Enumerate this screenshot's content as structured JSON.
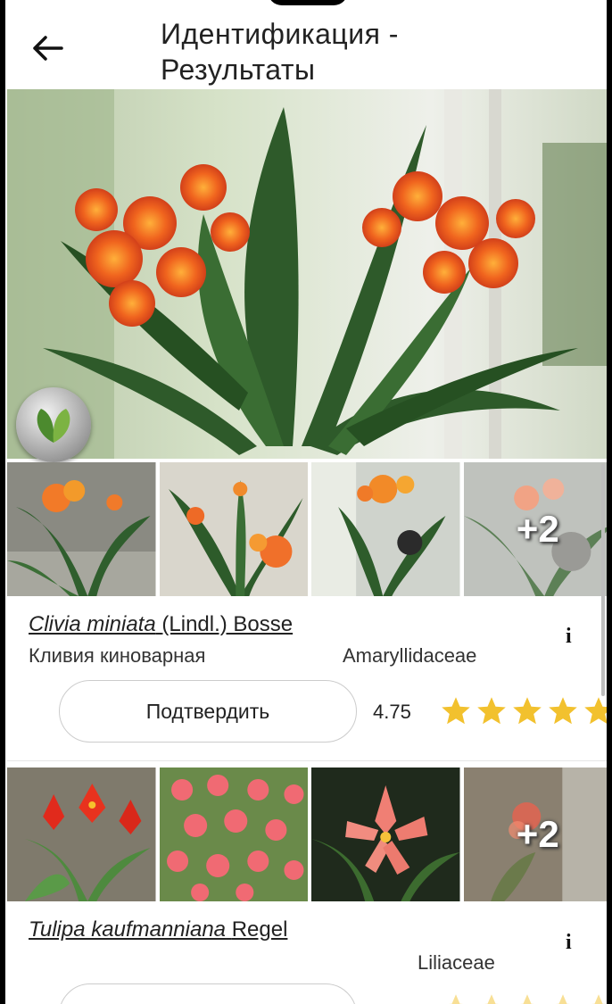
{
  "header": {
    "title_line1": "Идентификация -",
    "title_line2": "Результаты"
  },
  "results": [
    {
      "latin_name": "Clivia miniata",
      "author": "(Lindl.) Bosse",
      "common_name": "Кливия киноварная",
      "family": "Amaryllidaceae",
      "confirm_label": "Подтвердить",
      "score": "4.75",
      "rating": 4.75,
      "more_images": "+2",
      "accent": "#f2c12e"
    },
    {
      "latin_name": "Tulipa kaufmanniana",
      "author": "Regel",
      "common_name": "",
      "family": "Liliaceae",
      "more_images": "+2"
    }
  ],
  "icons": {
    "back": "arrow-left-icon",
    "info": "info-icon",
    "badge": "leaf-badge-icon",
    "star": "star-icon"
  }
}
